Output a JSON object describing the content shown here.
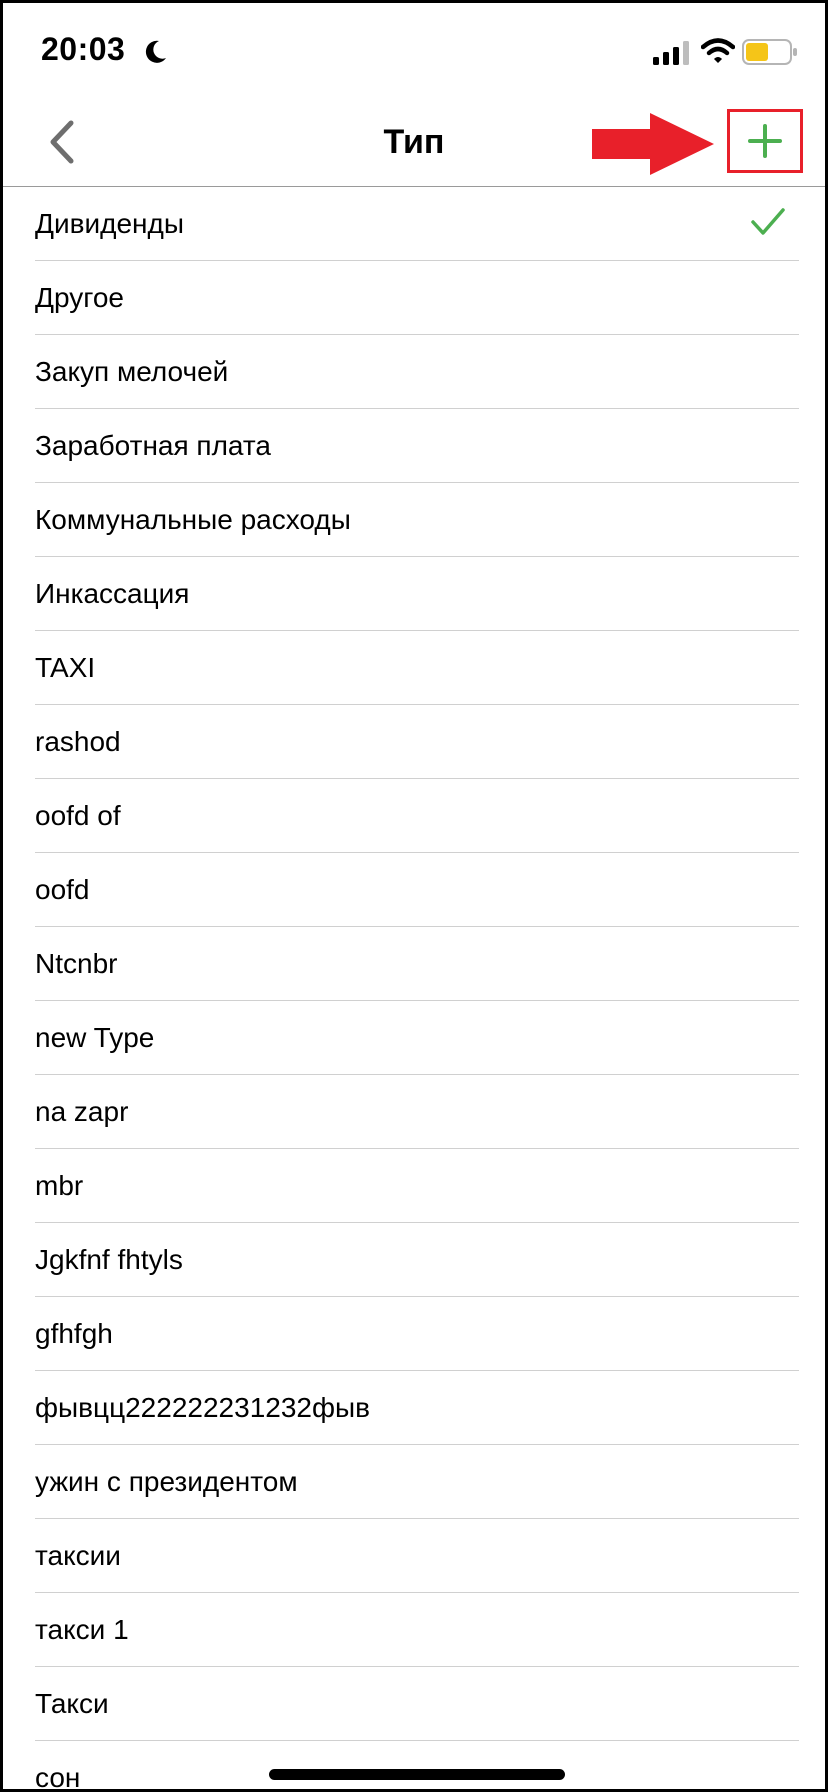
{
  "status_bar": {
    "time": "20:03",
    "battery_color": "#f5c518"
  },
  "nav": {
    "title": "Тип",
    "accent_color": "#4caf50",
    "annotation_color": "#e8202a"
  },
  "list": {
    "selected_index": 0,
    "items": [
      "Дивиденды",
      "Другое",
      "Закуп мелочей",
      "Заработная плата",
      "Коммунальные расходы",
      "Инкассация",
      "TAXI",
      "rashod",
      "oofd of",
      "oofd",
      "Ntcnbr",
      "new Type",
      "na zapr",
      "mbr",
      "Jgkfnf fhtyls",
      "gfhfgh",
      "фывцц222222231232фыв",
      "ужин с президентом",
      "таксии",
      "такси 1",
      "Такси",
      "сон"
    ]
  }
}
